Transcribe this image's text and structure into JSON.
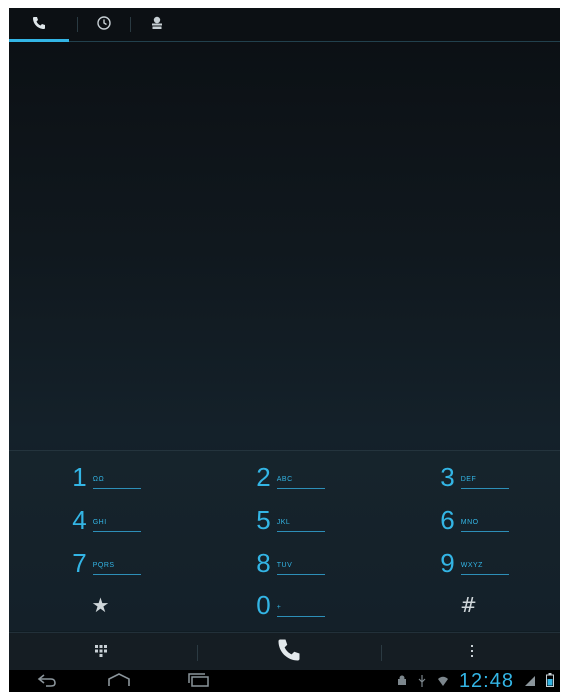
{
  "tabs": [
    {
      "name": "phone-icon",
      "active": true
    },
    {
      "name": "recent-icon",
      "active": false
    },
    {
      "name": "contacts-icon",
      "active": false
    }
  ],
  "dialpad": {
    "keys": [
      {
        "digit": "1",
        "letters": "ΩΩ"
      },
      {
        "digit": "2",
        "letters": "ABC"
      },
      {
        "digit": "3",
        "letters": "DEF"
      },
      {
        "digit": "4",
        "letters": "GHI"
      },
      {
        "digit": "5",
        "letters": "JKL"
      },
      {
        "digit": "6",
        "letters": "MNO"
      },
      {
        "digit": "7",
        "letters": "PQRS"
      },
      {
        "digit": "8",
        "letters": "TUV"
      },
      {
        "digit": "9",
        "letters": "WXYZ"
      },
      {
        "digit": "★",
        "letters": ""
      },
      {
        "digit": "0",
        "letters": "+"
      },
      {
        "digit": "#",
        "letters": ""
      }
    ]
  },
  "status": {
    "time": "12:48"
  },
  "colors": {
    "accent": "#33b5e5",
    "background": "#10181e"
  }
}
